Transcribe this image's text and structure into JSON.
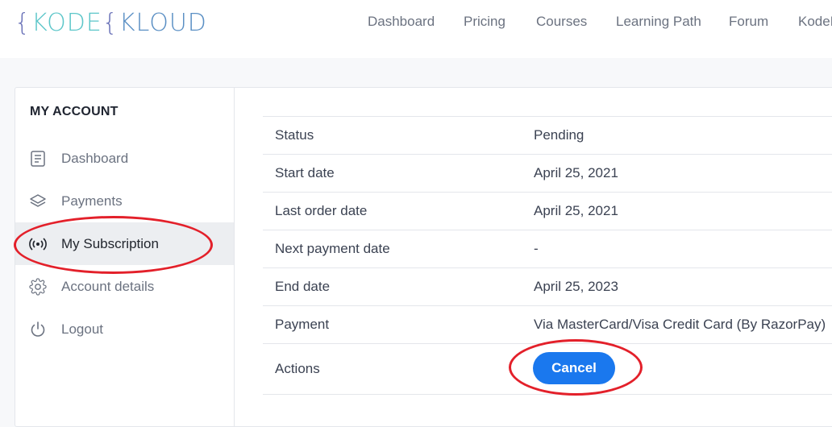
{
  "brand": {
    "logo_text_1": "KODE",
    "logo_text_2": "KLOUD"
  },
  "nav": {
    "items": [
      "Dashboard",
      "Pricing",
      "Courses",
      "Learning Path",
      "Forum",
      "KodeKl"
    ]
  },
  "sidebar": {
    "title": "MY ACCOUNT",
    "items": [
      {
        "label": "Dashboard",
        "icon": "document-icon"
      },
      {
        "label": "Payments",
        "icon": "layers-icon"
      },
      {
        "label": "My Subscription",
        "icon": "broadcast-icon",
        "active": true
      },
      {
        "label": "Account details",
        "icon": "gear-icon"
      },
      {
        "label": "Logout",
        "icon": "power-icon"
      }
    ]
  },
  "subscription": {
    "rows": [
      {
        "key": "Status",
        "value": "Pending"
      },
      {
        "key": "Start date",
        "value": "April 25, 2021"
      },
      {
        "key": "Last order date",
        "value": "April 25, 2021"
      },
      {
        "key": "Next payment date",
        "value": "-"
      },
      {
        "key": "End date",
        "value": "April 25, 2023"
      },
      {
        "key": "Payment",
        "value": "Via MasterCard/Visa Credit Card (By RazorPay)"
      }
    ],
    "actions_label": "Actions",
    "cancel_label": "Cancel"
  },
  "colors": {
    "accent": "#1a78ee",
    "annotation": "#e3202a",
    "logo_teal": "#5cc6c9",
    "logo_blue": "#5a8fc4"
  }
}
